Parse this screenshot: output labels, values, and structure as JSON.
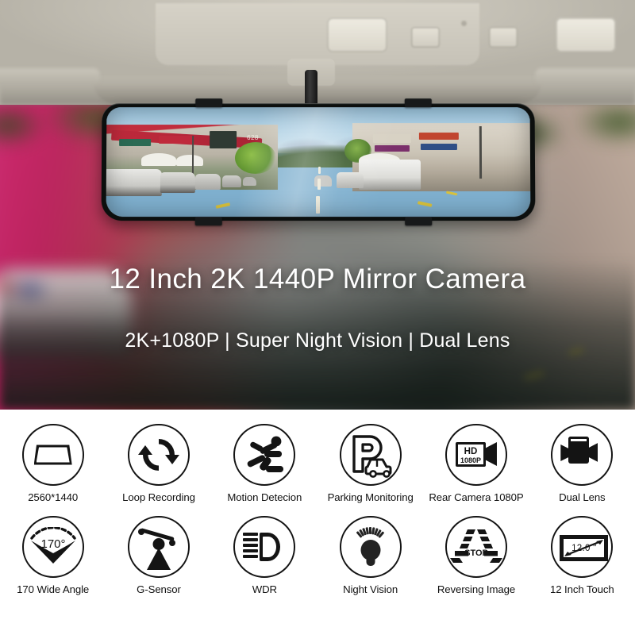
{
  "hero": {
    "title": "12 Inch 2K 1440P Mirror Camera",
    "subtitle": "2K+1080P | Super Night Vision | Dual Lens",
    "product": {
      "name": "rearview-mirror-dashcam",
      "mount_clips": 4,
      "screen_scene": "street view with parked cars, shops, mountains",
      "scene_sign_text": "628"
    },
    "text_color": "#ffffff"
  },
  "features": {
    "rows": [
      [
        {
          "icon": "mirror-screen-icon",
          "label": "2560*1440"
        },
        {
          "icon": "loop-recording-icon",
          "label": "Loop Recording"
        },
        {
          "icon": "motion-detection-icon",
          "label": "Motion Detecion"
        },
        {
          "icon": "parking-monitoring-icon",
          "label": "Parking Monitoring"
        },
        {
          "icon": "hd-camcorder-icon",
          "label": "Rear Camera 1080P",
          "badge_top": "HD",
          "badge_bottom": "1080P"
        },
        {
          "icon": "dual-lens-icon",
          "label": "Dual Lens"
        }
      ],
      [
        {
          "icon": "wide-angle-icon",
          "label": "170 Wide Angle",
          "badge": "170°"
        },
        {
          "icon": "g-sensor-icon",
          "label": "G-Sensor"
        },
        {
          "icon": "wdr-headlight-icon",
          "label": "WDR"
        },
        {
          "icon": "night-vision-icon",
          "label": "Night Vision"
        },
        {
          "icon": "reversing-image-icon",
          "label": "Reversing Image",
          "badge": "STOP"
        },
        {
          "icon": "touch-screen-icon",
          "label": "12 Inch Touch",
          "badge": "12.0 \""
        }
      ]
    ],
    "icon_color": "#141414",
    "background": "#ffffff"
  }
}
